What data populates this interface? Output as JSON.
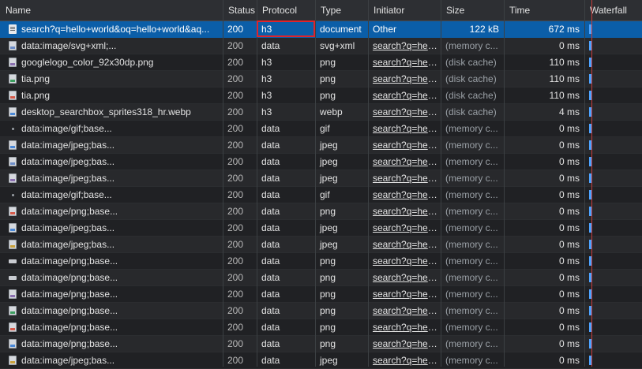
{
  "columns": {
    "name": "Name",
    "status": "Status",
    "protocol": "Protocol",
    "type": "Type",
    "initiator": "Initiator",
    "size": "Size",
    "time": "Time",
    "waterfall": "Waterfall"
  },
  "rows": [
    {
      "name": "search?q=hello+world&oq=hello+world&aq...",
      "status": "200",
      "protocol": "h3",
      "type": "document",
      "initiator": "Other",
      "size": "122 kB",
      "time": "672 ms",
      "icon": "document-icon",
      "selected": true
    },
    {
      "name": "data:image/svg+xml;...",
      "status": "200",
      "protocol": "data",
      "type": "svg+xml",
      "initiator": "search?q=hell...",
      "size": "(memory c...",
      "time": "0 ms",
      "icon": "image-icon"
    },
    {
      "name": "googlelogo_color_92x30dp.png",
      "status": "200",
      "protocol": "h3",
      "type": "png",
      "initiator": "search?q=hell...",
      "size": "(disk cache)",
      "time": "110 ms",
      "icon": "image-icon"
    },
    {
      "name": "tia.png",
      "status": "200",
      "protocol": "h3",
      "type": "png",
      "initiator": "search?q=hell...",
      "size": "(disk cache)",
      "time": "110 ms",
      "icon": "image-icon"
    },
    {
      "name": "tia.png",
      "status": "200",
      "protocol": "h3",
      "type": "png",
      "initiator": "search?q=hell...",
      "size": "(disk cache)",
      "time": "110 ms",
      "icon": "image-icon"
    },
    {
      "name": "desktop_searchbox_sprites318_hr.webp",
      "status": "200",
      "protocol": "h3",
      "type": "webp",
      "initiator": "search?q=hell...",
      "size": "(disk cache)",
      "time": "4 ms",
      "icon": "image-icon"
    },
    {
      "name": "data:image/gif;base...",
      "status": "200",
      "protocol": "data",
      "type": "gif",
      "initiator": "search?q=hell...",
      "size": "(memory c...",
      "time": "0 ms",
      "icon": "dot-icon"
    },
    {
      "name": "data:image/jpeg;bas...",
      "status": "200",
      "protocol": "data",
      "type": "jpeg",
      "initiator": "search?q=hell...",
      "size": "(memory c...",
      "time": "0 ms",
      "icon": "image-icon"
    },
    {
      "name": "data:image/jpeg;bas...",
      "status": "200",
      "protocol": "data",
      "type": "jpeg",
      "initiator": "search?q=hell...",
      "size": "(memory c...",
      "time": "0 ms",
      "icon": "image-icon"
    },
    {
      "name": "data:image/jpeg;bas...",
      "status": "200",
      "protocol": "data",
      "type": "jpeg",
      "initiator": "search?q=hell...",
      "size": "(memory c...",
      "time": "0 ms",
      "icon": "image-icon"
    },
    {
      "name": "data:image/gif;base...",
      "status": "200",
      "protocol": "data",
      "type": "gif",
      "initiator": "search?q=hell...",
      "size": "(memory c...",
      "time": "0 ms",
      "icon": "dot-icon"
    },
    {
      "name": "data:image/png;base...",
      "status": "200",
      "protocol": "data",
      "type": "png",
      "initiator": "search?q=hell...",
      "size": "(memory c...",
      "time": "0 ms",
      "icon": "image-icon"
    },
    {
      "name": "data:image/jpeg;bas...",
      "status": "200",
      "protocol": "data",
      "type": "jpeg",
      "initiator": "search?q=hell...",
      "size": "(memory c...",
      "time": "0 ms",
      "icon": "image-icon"
    },
    {
      "name": "data:image/jpeg;bas...",
      "status": "200",
      "protocol": "data",
      "type": "jpeg",
      "initiator": "search?q=hell...",
      "size": "(memory c...",
      "time": "0 ms",
      "icon": "image-icon"
    },
    {
      "name": "data:image/png;base...",
      "status": "200",
      "protocol": "data",
      "type": "png",
      "initiator": "search?q=hell...",
      "size": "(memory c...",
      "time": "0 ms",
      "icon": "bar-icon"
    },
    {
      "name": "data:image/png;base...",
      "status": "200",
      "protocol": "data",
      "type": "png",
      "initiator": "search?q=hell...",
      "size": "(memory c...",
      "time": "0 ms",
      "icon": "bar-icon"
    },
    {
      "name": "data:image/png;base...",
      "status": "200",
      "protocol": "data",
      "type": "png",
      "initiator": "search?q=hell...",
      "size": "(memory c...",
      "time": "0 ms",
      "icon": "image-icon"
    },
    {
      "name": "data:image/png;base...",
      "status": "200",
      "protocol": "data",
      "type": "png",
      "initiator": "search?q=hell...",
      "size": "(memory c...",
      "time": "0 ms",
      "icon": "image-icon"
    },
    {
      "name": "data:image/png;base...",
      "status": "200",
      "protocol": "data",
      "type": "png",
      "initiator": "search?q=hell...",
      "size": "(memory c...",
      "time": "0 ms",
      "icon": "image-icon"
    },
    {
      "name": "data:image/png;base...",
      "status": "200",
      "protocol": "data",
      "type": "png",
      "initiator": "search?q=hell...",
      "size": "(memory c...",
      "time": "0 ms",
      "icon": "image-icon"
    },
    {
      "name": "data:image/jpeg;bas...",
      "status": "200",
      "protocol": "data",
      "type": "jpeg",
      "initiator": "search?q=hell...",
      "size": "(memory c...",
      "time": "0 ms",
      "icon": "image-icon"
    }
  ],
  "colors": {
    "background": "#202124",
    "selected_row": "#0b5ea8",
    "highlight_box": "#e0242b",
    "waterfall_bar": "#4da3ff",
    "waterfall_marker": "#c43b3b"
  }
}
